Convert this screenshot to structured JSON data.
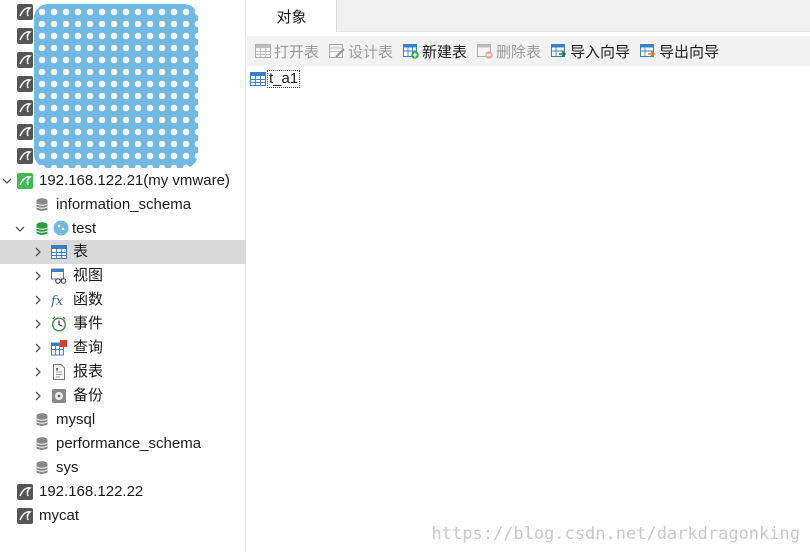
{
  "sidebar": {
    "connections_hidden_count": 7,
    "conn1": {
      "label": "192.168.122.21(my vmware)"
    },
    "db_info": {
      "label": "information_schema"
    },
    "db_test": {
      "label": "test"
    },
    "items": [
      {
        "label": "表",
        "icon": "table-icon"
      },
      {
        "label": "视图",
        "icon": "view-icon"
      },
      {
        "label": "函数",
        "icon": "function-icon"
      },
      {
        "label": "事件",
        "icon": "event-icon"
      },
      {
        "label": "查询",
        "icon": "query-icon"
      },
      {
        "label": "报表",
        "icon": "report-icon"
      },
      {
        "label": "备份",
        "icon": "backup-icon"
      }
    ],
    "db_mysql": {
      "label": "mysql"
    },
    "db_perf": {
      "label": "performance_schema"
    },
    "db_sys": {
      "label": "sys"
    },
    "conn2": {
      "label": "192.168.122.22"
    },
    "conn3": {
      "label": "mycat"
    }
  },
  "main": {
    "tab": {
      "label": "对象"
    },
    "toolbar": {
      "open": "打开表",
      "design": "设计表",
      "new": "新建表",
      "delete": "删除表",
      "import": "导入向导",
      "export": "导出向导"
    },
    "objects": [
      {
        "label": "t_a1"
      }
    ]
  },
  "watermark": "https://blog.csdn.net/darkdragonking",
  "colors": {
    "selected_row": "#d9d9d9",
    "connection_active": "#3cba54",
    "database_active": "#2e9b3f"
  }
}
